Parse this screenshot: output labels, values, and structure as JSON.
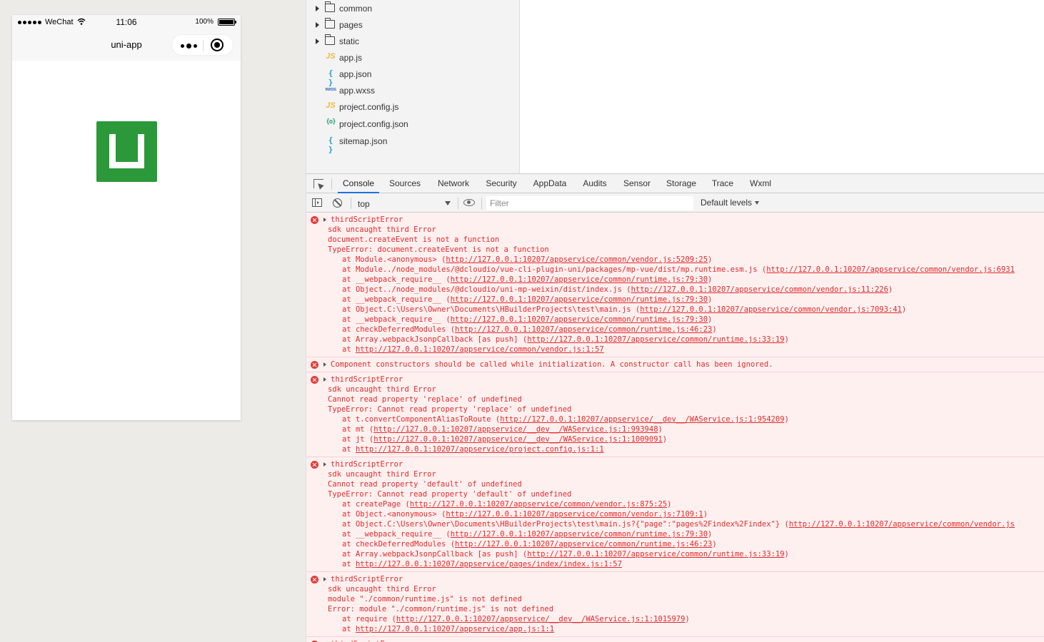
{
  "simulator": {
    "carrier": "WeChat",
    "time": "11:06",
    "battery": "100%",
    "battery_level": 1.0,
    "nav_title": "uni-app",
    "logo_color": "#2b9939"
  },
  "file_tree": [
    {
      "type": "folder",
      "label": "common"
    },
    {
      "type": "folder",
      "label": "pages"
    },
    {
      "type": "folder",
      "label": "static"
    },
    {
      "type": "js",
      "icon_text": "JS",
      "label": "app.js"
    },
    {
      "type": "json",
      "icon_text": "{ }",
      "label": "app.json"
    },
    {
      "type": "wxss",
      "icon_text": "wxss",
      "label": "app.wxss"
    },
    {
      "type": "js",
      "icon_text": "JS",
      "label": "project.config.js"
    },
    {
      "type": "cfg",
      "icon_text": "{o}",
      "label": "project.config.json"
    },
    {
      "type": "json",
      "icon_text": "{ }",
      "label": "sitemap.json"
    }
  ],
  "devtools": {
    "tabs": [
      "Console",
      "Sources",
      "Network",
      "Security",
      "AppData",
      "Audits",
      "Sensor",
      "Storage",
      "Trace",
      "Wxml"
    ],
    "active_tab": "Console",
    "context": "top",
    "filter_placeholder": "Filter",
    "levels": "Default levels"
  },
  "console_entries": [
    {
      "expandable": true,
      "first": "thirdScriptError",
      "lines": [
        "sdk uncaught third Error",
        "document.createEvent is not a function",
        "TypeError: document.createEvent is not a function"
      ],
      "frames": [
        {
          "fn": "at Module.<anonymous> (",
          "url": "http://127.0.0.1:10207/appservice/common/vendor.js:5209:25",
          "end": ")"
        },
        {
          "fn": "at Module../node_modules/@dcloudio/vue-cli-plugin-uni/packages/mp-vue/dist/mp.runtime.esm.js (",
          "url": "http://127.0.0.1:10207/appservice/common/vendor.js:6931",
          "end": ""
        },
        {
          "fn": "at __webpack_require__ (",
          "url": "http://127.0.0.1:10207/appservice/common/runtime.js:79:30",
          "end": ")"
        },
        {
          "fn": "at Object../node_modules/@dcloudio/uni-mp-weixin/dist/index.js (",
          "url": "http://127.0.0.1:10207/appservice/common/vendor.js:11:226",
          "end": ")"
        },
        {
          "fn": "at __webpack_require__ (",
          "url": "http://127.0.0.1:10207/appservice/common/runtime.js:79:30",
          "end": ")"
        },
        {
          "fn": "at Object.C:\\Users\\Owner\\Documents\\HBuilderProjects\\test\\main.js (",
          "url": "http://127.0.0.1:10207/appservice/common/vendor.js:7093:41",
          "end": ")"
        },
        {
          "fn": "at __webpack_require__ (",
          "url": "http://127.0.0.1:10207/appservice/common/runtime.js:79:30",
          "end": ")"
        },
        {
          "fn": "at checkDeferredModules (",
          "url": "http://127.0.0.1:10207/appservice/common/runtime.js:46:23",
          "end": ")"
        },
        {
          "fn": "at Array.webpackJsonpCallback [as push] (",
          "url": "http://127.0.0.1:10207/appservice/common/runtime.js:33:19",
          "end": ")"
        },
        {
          "fn": "at ",
          "url": "http://127.0.0.1:10207/appservice/common/vendor.js:1:57",
          "end": ""
        }
      ]
    },
    {
      "expandable": true,
      "first": "Component constructors should be called while initialization. A constructor call has been ignored.",
      "lines": [],
      "frames": []
    },
    {
      "expandable": true,
      "first": "thirdScriptError",
      "lines": [
        "sdk uncaught third Error",
        "Cannot read property 'replace' of undefined",
        "TypeError: Cannot read property 'replace' of undefined"
      ],
      "frames": [
        {
          "fn": "at t.convertComponentAliasToRoute (",
          "url": "http://127.0.0.1:10207/appservice/__dev__/WAService.js:1:954209",
          "end": ")"
        },
        {
          "fn": "at mt (",
          "url": "http://127.0.0.1:10207/appservice/__dev__/WAService.js:1:993948",
          "end": ")"
        },
        {
          "fn": "at jt (",
          "url": "http://127.0.0.1:10207/appservice/__dev__/WAService.js:1:1009091",
          "end": ")"
        },
        {
          "fn": "at ",
          "url": "http://127.0.0.1:10207/appservice/project.config.js:1:1",
          "end": ""
        }
      ]
    },
    {
      "expandable": true,
      "first": "thirdScriptError",
      "lines": [
        "sdk uncaught third Error",
        "Cannot read property 'default' of undefined",
        "TypeError: Cannot read property 'default' of undefined"
      ],
      "frames": [
        {
          "fn": "at createPage (",
          "url": "http://127.0.0.1:10207/appservice/common/vendor.js:875:25",
          "end": ")"
        },
        {
          "fn": "at Object.<anonymous> (",
          "url": "http://127.0.0.1:10207/appservice/common/vendor.js:7109:1",
          "end": ")"
        },
        {
          "fn": "at Object.C:\\Users\\Owner\\Documents\\HBuilderProjects\\test\\main.js?{\"page\":\"pages%2Findex%2Findex\"} (",
          "url": "http://127.0.0.1:10207/appservice/common/vendor.js",
          "end": ""
        },
        {
          "fn": "at __webpack_require__ (",
          "url": "http://127.0.0.1:10207/appservice/common/runtime.js:79:30",
          "end": ")"
        },
        {
          "fn": "at checkDeferredModules (",
          "url": "http://127.0.0.1:10207/appservice/common/runtime.js:46:23",
          "end": ")"
        },
        {
          "fn": "at Array.webpackJsonpCallback [as push] (",
          "url": "http://127.0.0.1:10207/appservice/common/runtime.js:33:19",
          "end": ")"
        },
        {
          "fn": "at ",
          "url": "http://127.0.0.1:10207/appservice/pages/index/index.js:1:57",
          "end": ""
        }
      ]
    },
    {
      "expandable": true,
      "first": "thirdScriptError",
      "lines": [
        "sdk uncaught third Error",
        "module \"./common/runtime.js\" is not defined",
        "Error: module \"./common/runtime.js\" is not defined"
      ],
      "frames": [
        {
          "fn": "at require (",
          "url": "http://127.0.0.1:10207/appservice/__dev__/WAService.js:1:1015979",
          "end": ")"
        },
        {
          "fn": "at ",
          "url": "http://127.0.0.1:10207/appservice/app.js:1:1",
          "end": ""
        }
      ]
    },
    {
      "expandable": true,
      "first": "thirdScriptError",
      "lines": [],
      "frames": []
    }
  ]
}
